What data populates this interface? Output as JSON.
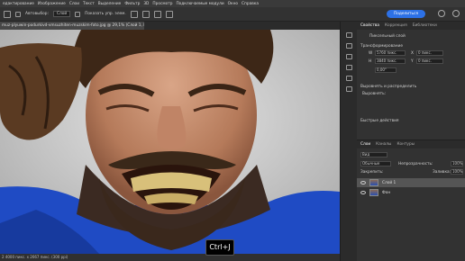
{
  "menu": [
    "едактирование",
    "Изображение",
    "Слои",
    "Текст",
    "Выделение",
    "Фильтр",
    "3D",
    "Просмотр",
    "Подключаемые модули",
    "Окно",
    "Справка"
  ],
  "options": {
    "auto_select_label": "Автовыбор:",
    "auto_select_value": "Слой",
    "transform_label": "Показать упр. элем.",
    "share_label": "Поделиться"
  },
  "document": {
    "tab_title": "muz-plyuwin-podurkivd-vmsuzhiten-muzskim-foto.jpg @ 29,1% (Слой 1, RGB/8) *",
    "status": "2 4000 пикс. х 2667 пикс. (300 ppi)"
  },
  "shortcut": "Ctrl+J",
  "right_panel": {
    "tabs": [
      "Свойства",
      "Коррекция",
      "Библиотеки"
    ],
    "layer_type": "Пиксельный слой",
    "transform_header": "Трансформирование",
    "w_value": "5760 пикс.",
    "h_value": "3840 пикс.",
    "x_value": "0 пикс.",
    "y_value": "0 пикс.",
    "angle_value": "0,00°",
    "align_header": "Выровнять и распределить",
    "align_sub": "Выровнять:",
    "quick_actions": "Быстрые действия"
  },
  "layers_panel": {
    "tabs": [
      "Слои",
      "Каналы",
      "Контуры"
    ],
    "search_placeholder": "Вид",
    "blend_mode": "Обычные",
    "opacity_label": "Непрозрачность:",
    "opacity_value": "100%",
    "lock_label": "Закрепить:",
    "fill_label": "Заливка:",
    "fill_value": "100%",
    "layers": [
      {
        "name": "Слой 1",
        "selected": true
      },
      {
        "name": "Фон",
        "selected": false
      }
    ]
  }
}
